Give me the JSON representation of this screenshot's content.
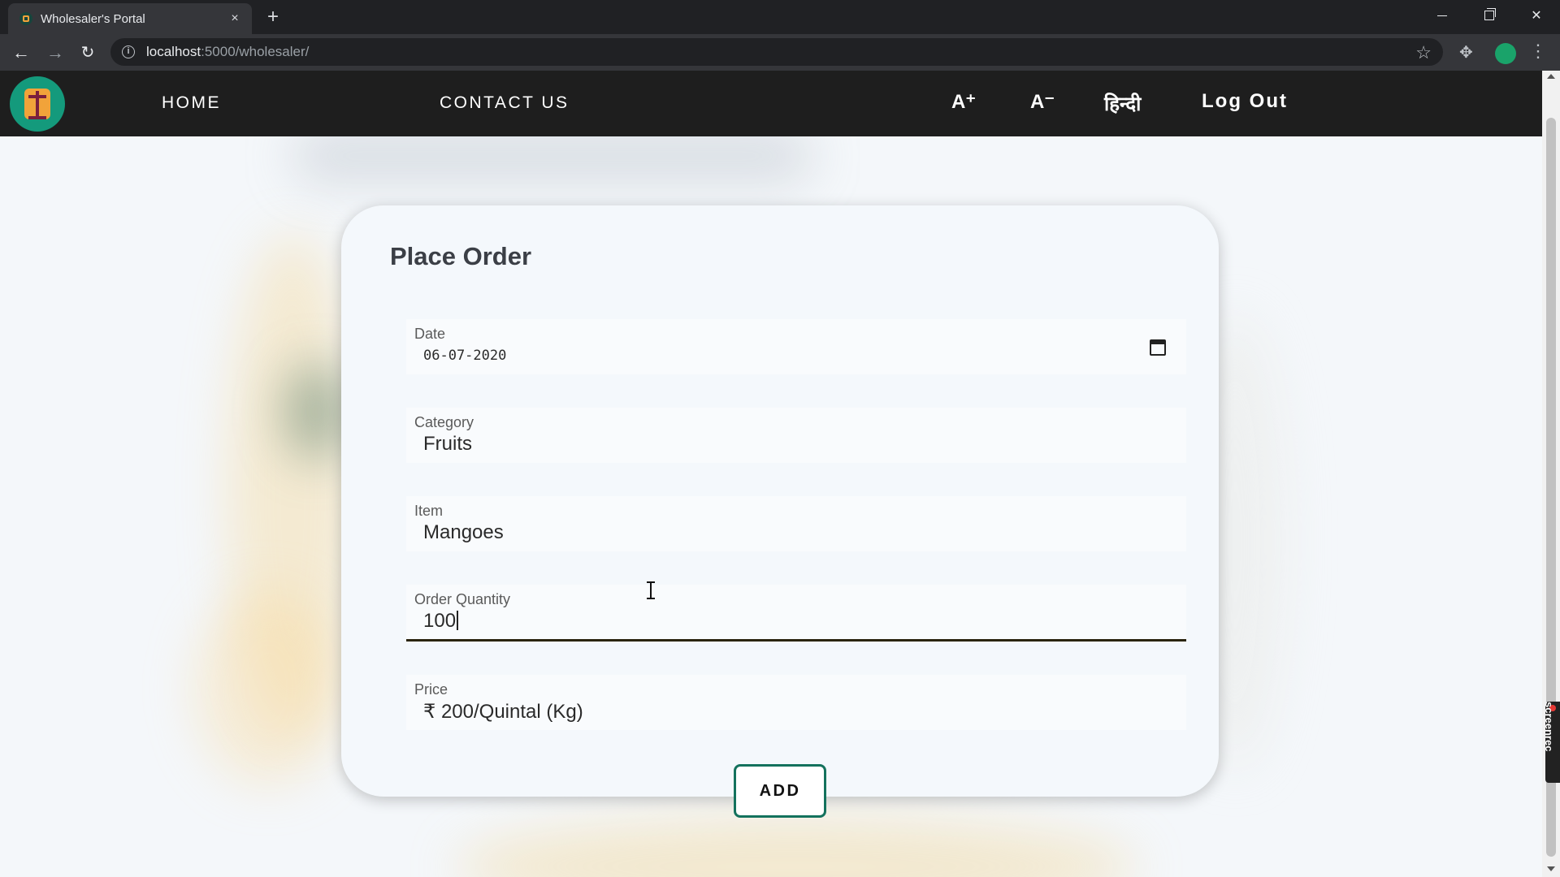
{
  "browser": {
    "tab_title": "Wholesaler's Portal",
    "tab_close": "×",
    "new_tab": "+",
    "url_host": "localhost",
    "url_path": ":5000/wholesaler/",
    "info_icon": "i"
  },
  "topnav": {
    "home": "HOME",
    "contact": "CONTACT US",
    "font_increase": "A⁺",
    "font_decrease": "A⁻",
    "language": "हिन्दी",
    "logout": "Log Out"
  },
  "form": {
    "title": "Place Order",
    "fields": [
      {
        "label": "Date",
        "value": "06-07-2020"
      },
      {
        "label": "Category",
        "value": "Fruits"
      },
      {
        "label": "Item",
        "value": "Mangoes"
      },
      {
        "label": "Order Quantity",
        "value": "100"
      },
      {
        "label": "Price",
        "value": "₹ 200/Quintal (Kg)"
      }
    ],
    "add_label": "ADD"
  },
  "watermark": "screenrec",
  "icons": {
    "back": "back-arrow-icon",
    "forward": "forward-arrow-icon",
    "reload": "reload-icon",
    "bookmark": "star-icon",
    "extensions": "puzzle-icon",
    "menu": "kebab-menu-icon",
    "calendar": "calendar-icon"
  },
  "colors": {
    "navbar": "#1e1e1e",
    "logo_bg": "#149a7c",
    "button_border": "#14725d",
    "card_bg": "#f4f8fc"
  }
}
